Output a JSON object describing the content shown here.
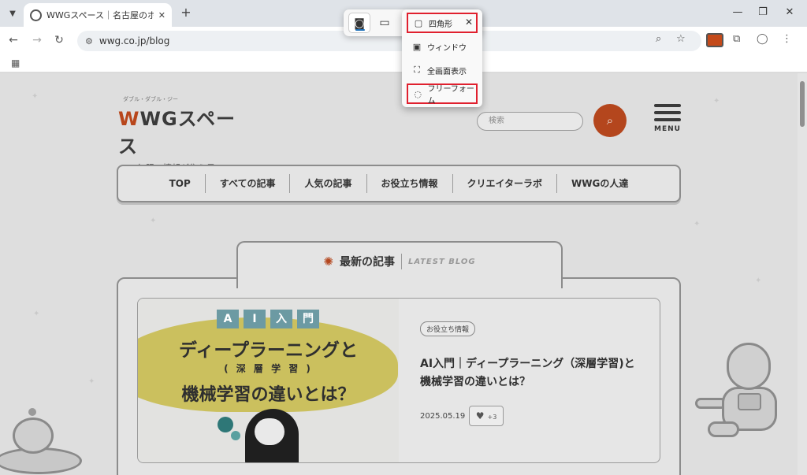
{
  "browser": {
    "tab_title": "WWGスペース｜名古屋のホームペー",
    "url": "wwg.co.jp/blog"
  },
  "site": {
    "logo_ruby": "ダブル・ダブル・ジー",
    "logo_text": "WWGスペース",
    "logo_first": "W",
    "logo_rest": "WGスペース",
    "tagline": "無限の情報が集う星",
    "search_placeholder": "検索",
    "menu_label": "MENU",
    "nav": [
      "TOP",
      "すべての記事",
      "人気の記事",
      "お役立ち情報",
      "クリエイターラボ",
      "WWGの人達"
    ],
    "latest_title": "最新の記事",
    "latest_en": "LATEST BLOG"
  },
  "article": {
    "thumb_ai": [
      "A",
      "I",
      "入",
      "門"
    ],
    "thumb_line1": "ディープラーニングと",
    "thumb_line2": "( 深 層 学 習 )",
    "thumb_line3": "機械学習の違いとは？",
    "tag": "お役立ち情報",
    "title": "AI入門｜ディープラーニング（深層学習)と機械学習の違いとは？",
    "date": "2025.05.19",
    "likes": "+3"
  },
  "snip": {
    "modes": [
      "camera-icon",
      "video-icon"
    ],
    "shapes": [
      {
        "label": "四角形",
        "icon": "rectangle-icon",
        "highlighted": true
      },
      {
        "label": "ウィンドウ",
        "icon": "window-icon",
        "highlighted": false
      },
      {
        "label": "全画面表示",
        "icon": "fullscreen-icon",
        "highlighted": false
      },
      {
        "label": "フリーフォーム",
        "icon": "freeform-icon",
        "highlighted": true
      }
    ],
    "highlight_color": "#e0202e"
  },
  "colors": {
    "brand": "#b4461d",
    "accent_blue": "#1d6fb8"
  }
}
